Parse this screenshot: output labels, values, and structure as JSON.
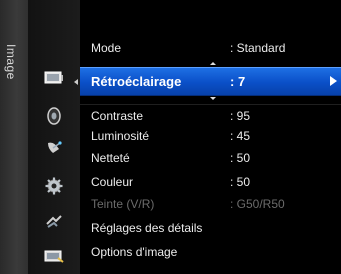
{
  "side_tab": {
    "label": "Image"
  },
  "menu": {
    "items": [
      {
        "label": "Mode",
        "value": ": Standard"
      },
      {
        "label": "Rétroéclairage",
        "value": ": 7"
      },
      {
        "label": "Contraste",
        "value": ": 95"
      },
      {
        "label": "Luminosité",
        "value": ": 45"
      },
      {
        "label": "Netteté",
        "value": ": 50"
      },
      {
        "label": "Couleur",
        "value": ": 50"
      },
      {
        "label": "Teinte (V/R)",
        "value": ": G50/R50"
      },
      {
        "label": "Réglages des détails",
        "value": ""
      },
      {
        "label": "Options d'image",
        "value": ""
      }
    ]
  },
  "icons": [
    "picture-icon",
    "sound-icon",
    "satellite-icon",
    "setup-icon",
    "input-icon",
    "support-icon"
  ],
  "colors": {
    "highlight": "#0a4fc7",
    "text": "#ececec",
    "disabled_text": "#6b6b6b"
  }
}
